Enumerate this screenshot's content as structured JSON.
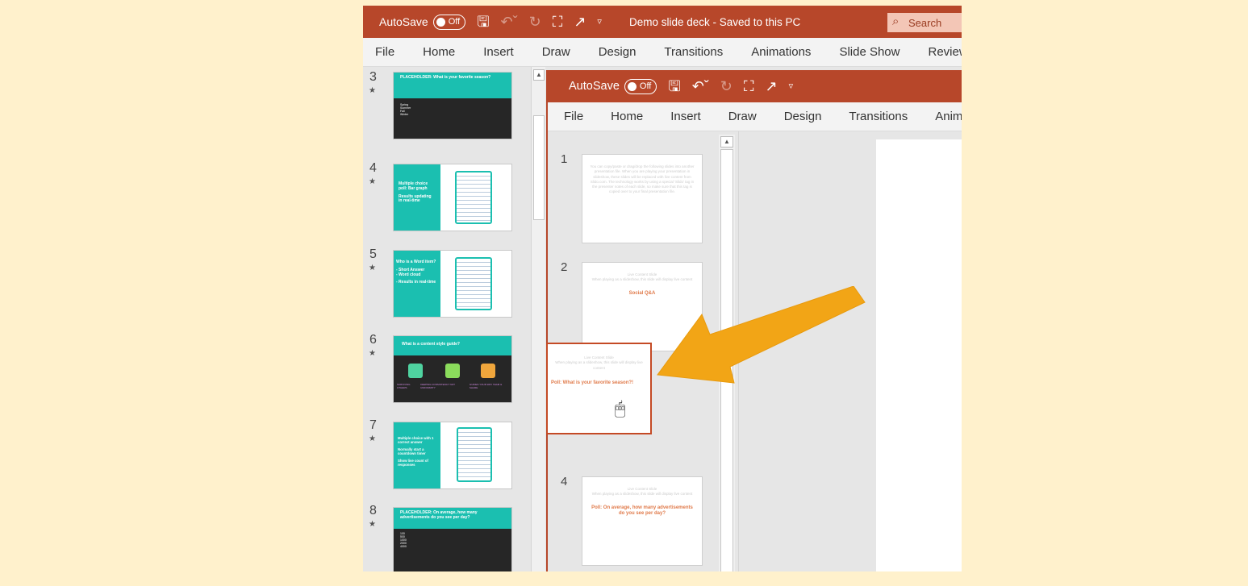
{
  "outer_window": {
    "autosave_label": "AutoSave",
    "toggle_label": "Off",
    "doc_title": "Demo slide deck - Saved to this PC",
    "search_placeholder": "Search",
    "ribbon_tabs": [
      "File",
      "Home",
      "Insert",
      "Draw",
      "Design",
      "Transitions",
      "Animations",
      "Slide Show",
      "Review"
    ],
    "thumbnails": [
      {
        "number": "3",
        "title": "PLACEHOLDER:  What is your favorite season?",
        "options": [
          "Spring",
          "Summer",
          "Fall",
          "Winter"
        ]
      },
      {
        "number": "4",
        "title": "Multiple choice poll: Bar graph",
        "subtitle": "Results updating in real-time"
      },
      {
        "number": "5",
        "title": "Who is a Word item?",
        "lines": [
          "- Short Answer",
          "- Word cloud",
          "- Results in real-time"
        ]
      },
      {
        "number": "6",
        "title": "What is a content style guide?",
        "captions": [
          "SURVIVING OTHERS",
          "KEEPING CONSISTENCY NOT UNIFORMITY",
          "GUIDES YOUR WAY TEAM & SHARE"
        ]
      },
      {
        "number": "7",
        "title": "Multiple choice with 1 correct answer",
        "lines": [
          "Normally start a countdown timer",
          "Show live count of responses"
        ]
      },
      {
        "number": "8",
        "title": "PLACEHOLDER:  On average, how many advertisements do you see per day?",
        "options": [
          "100",
          "500",
          "1000",
          "2000",
          "4000"
        ]
      }
    ]
  },
  "inner_window": {
    "autosave_label": "AutoSave",
    "toggle_label": "Off",
    "ribbon_tabs": [
      "File",
      "Home",
      "Insert",
      "Draw",
      "Design",
      "Transitions",
      "Anim"
    ],
    "slides": [
      {
        "number": "1",
        "faint": "You can copy/paste or drag/drop the following slides into another presentation file. When you are playing your presentation in slideshow, these slides will be replaced with live content from Slido.com. The technology works by using a special 'Slido' tag in the presenter notes of each slide, so make sure that this tag is copied over to your final presentation file.",
        "title": ""
      },
      {
        "number": "2",
        "faint": "Live Content Slide",
        "faint2": "When playing as a slideshow, this slide will display live content",
        "title": "Social Q&A"
      },
      {
        "number": "4",
        "faint": "Live Content Slide",
        "faint2": "When playing as a slideshow, this slide will display live content",
        "title": "Poll: On average, how many advertisements do you see per day?"
      }
    ],
    "dragged_slide": {
      "faint": "Live Content Slide",
      "faint2": "When playing as a slideshow, this slide will display live content",
      "title": "Poll: What is your favorite season?!"
    }
  },
  "colors": {
    "titlebar": "#b7472a",
    "teal": "#1bbfb0",
    "arrow": "#f2a516",
    "background": "#fff1cc"
  }
}
